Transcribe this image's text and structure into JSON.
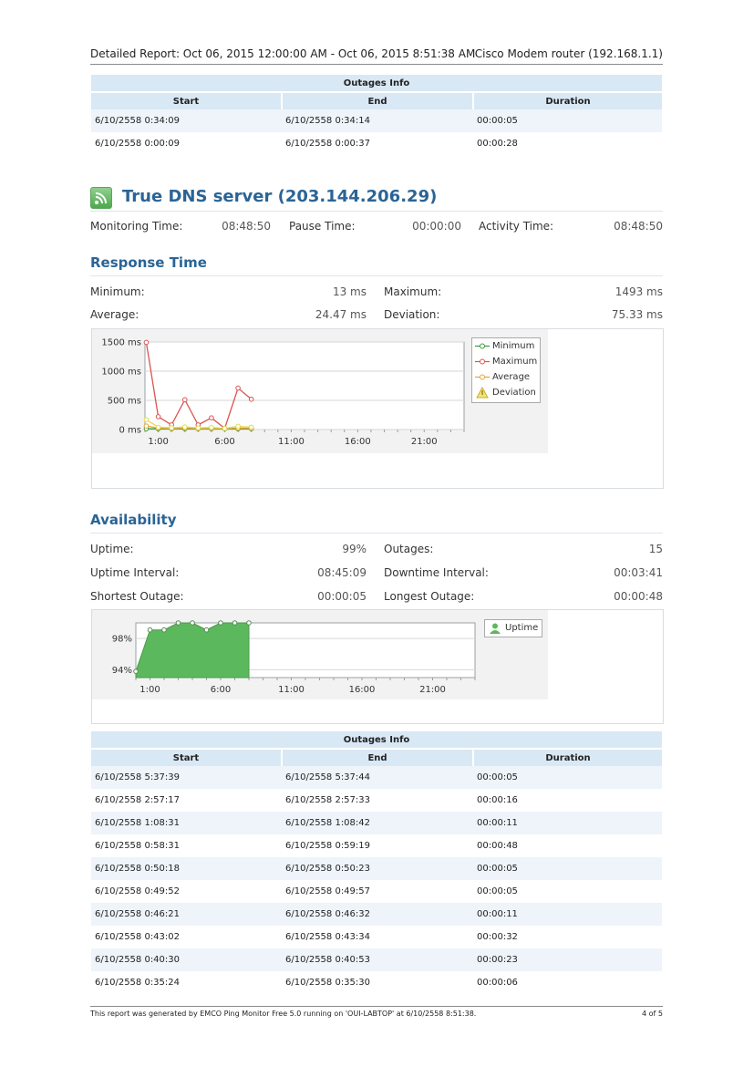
{
  "header": {
    "report_range": "Detailed Report: Oct 06, 2015 12:00:00 AM - Oct 06, 2015 8:51:38 AM",
    "device": "Cisco Modem router (192.168.1.1)"
  },
  "outages_top": {
    "caption": "Outages Info",
    "columns": [
      "Start",
      "End",
      "Duration"
    ],
    "rows": [
      [
        "6/10/2558 0:34:09",
        "6/10/2558 0:34:14",
        "00:00:05"
      ],
      [
        "6/10/2558 0:00:09",
        "6/10/2558 0:00:37",
        "00:00:28"
      ]
    ]
  },
  "server": {
    "title": "True DNS server (203.144.206.29)",
    "icon": "wifi-signal-icon",
    "monitoring_label": "Monitoring Time:",
    "monitoring_value": "08:48:50",
    "pause_label": "Pause Time:",
    "pause_value": "00:00:00",
    "activity_label": "Activity Time:",
    "activity_value": "08:48:50"
  },
  "response": {
    "title": "Response Time",
    "minimum_label": "Minimum:",
    "minimum_value": "13 ms",
    "maximum_label": "Maximum:",
    "maximum_value": "1493 ms",
    "average_label": "Average:",
    "average_value": "24.47 ms",
    "deviation_label": "Deviation:",
    "deviation_value": "75.33 ms"
  },
  "availability": {
    "title": "Availability",
    "uptime_label": "Uptime:",
    "uptime_value": "99%",
    "outages_label": "Outages:",
    "outages_value": "15",
    "uptime_interval_label": "Uptime Interval:",
    "uptime_interval_value": "08:45:09",
    "downtime_interval_label": "Downtime Interval:",
    "downtime_interval_value": "00:03:41",
    "shortest_label": "Shortest Outage:",
    "shortest_value": "00:00:05",
    "longest_label": "Longest Outage:",
    "longest_value": "00:00:48"
  },
  "chart_data": [
    {
      "type": "line",
      "y_tick_labels": [
        "1500 ms",
        "1000 ms",
        "500 ms",
        "0 ms"
      ],
      "y_ticks": [
        1500,
        1000,
        500,
        0
      ],
      "x_tick_labels": [
        "1:00",
        "6:00",
        "11:00",
        "16:00",
        "21:00"
      ],
      "x_ticks": [
        1,
        6,
        11,
        16,
        21
      ],
      "xlim": [
        0,
        24
      ],
      "ylim": [
        0,
        1500
      ],
      "grid": true,
      "legend_position": "right",
      "series": [
        {
          "name": "Minimum",
          "color": "#3a9a3a",
          "x": [
            0.1,
            1.0,
            2.0,
            3.0,
            4.0,
            5.0,
            6.0,
            7.0,
            8.0
          ],
          "values": [
            13,
            13,
            13,
            13,
            13,
            13,
            13,
            13,
            13
          ]
        },
        {
          "name": "Maximum",
          "color": "#d9534f",
          "x": [
            0.1,
            1.0,
            2.0,
            3.0,
            4.0,
            5.0,
            6.0,
            7.0,
            8.0
          ],
          "values": [
            1493,
            220,
            80,
            510,
            80,
            200,
            20,
            710,
            520
          ]
        },
        {
          "name": "Average",
          "color": "#e8a33c",
          "x": [
            0.1,
            1.0,
            2.0,
            3.0,
            4.0,
            5.0,
            6.0,
            7.0,
            8.0
          ],
          "values": [
            60,
            25,
            20,
            25,
            20,
            22,
            18,
            25,
            22
          ]
        },
        {
          "name": "Deviation",
          "color": "#e6d84a",
          "x": [
            0.1,
            1.0,
            2.0,
            3.0,
            4.0,
            5.0,
            6.0,
            7.0,
            8.0
          ],
          "values": [
            170,
            40,
            30,
            45,
            28,
            35,
            20,
            55,
            40
          ]
        }
      ]
    },
    {
      "type": "area",
      "y_tick_labels": [
        "98%",
        "94%"
      ],
      "y_ticks": [
        98,
        94
      ],
      "x_tick_labels": [
        "1:00",
        "6:00",
        "11:00",
        "16:00",
        "21:00"
      ],
      "x_ticks": [
        1,
        6,
        11,
        16,
        21
      ],
      "xlim": [
        0,
        24
      ],
      "ylim": [
        93,
        100
      ],
      "grid": true,
      "legend_position": "right",
      "series": [
        {
          "name": "Uptime",
          "color": "#5cb85c",
          "x": [
            0,
            1,
            2,
            3,
            4,
            5,
            6,
            7,
            8
          ],
          "values": [
            93.8,
            99.1,
            99.1,
            100,
            100,
            99.1,
            100,
            100,
            100
          ]
        }
      ]
    }
  ],
  "outages_bottom": {
    "caption": "Outages Info",
    "columns": [
      "Start",
      "End",
      "Duration"
    ],
    "rows": [
      [
        "6/10/2558 5:37:39",
        "6/10/2558 5:37:44",
        "00:00:05"
      ],
      [
        "6/10/2558 2:57:17",
        "6/10/2558 2:57:33",
        "00:00:16"
      ],
      [
        "6/10/2558 1:08:31",
        "6/10/2558 1:08:42",
        "00:00:11"
      ],
      [
        "6/10/2558 0:58:31",
        "6/10/2558 0:59:19",
        "00:00:48"
      ],
      [
        "6/10/2558 0:50:18",
        "6/10/2558 0:50:23",
        "00:00:05"
      ],
      [
        "6/10/2558 0:49:52",
        "6/10/2558 0:49:57",
        "00:00:05"
      ],
      [
        "6/10/2558 0:46:21",
        "6/10/2558 0:46:32",
        "00:00:11"
      ],
      [
        "6/10/2558 0:43:02",
        "6/10/2558 0:43:34",
        "00:00:32"
      ],
      [
        "6/10/2558 0:40:30",
        "6/10/2558 0:40:53",
        "00:00:23"
      ],
      [
        "6/10/2558 0:35:24",
        "6/10/2558 0:35:30",
        "00:00:06"
      ]
    ]
  },
  "footer": {
    "generated": "This report was generated by EMCO Ping Monitor Free 5.0 running on 'OUI-LABTOP' at 6/10/2558 8:51:38.",
    "page": "4 of 5"
  }
}
